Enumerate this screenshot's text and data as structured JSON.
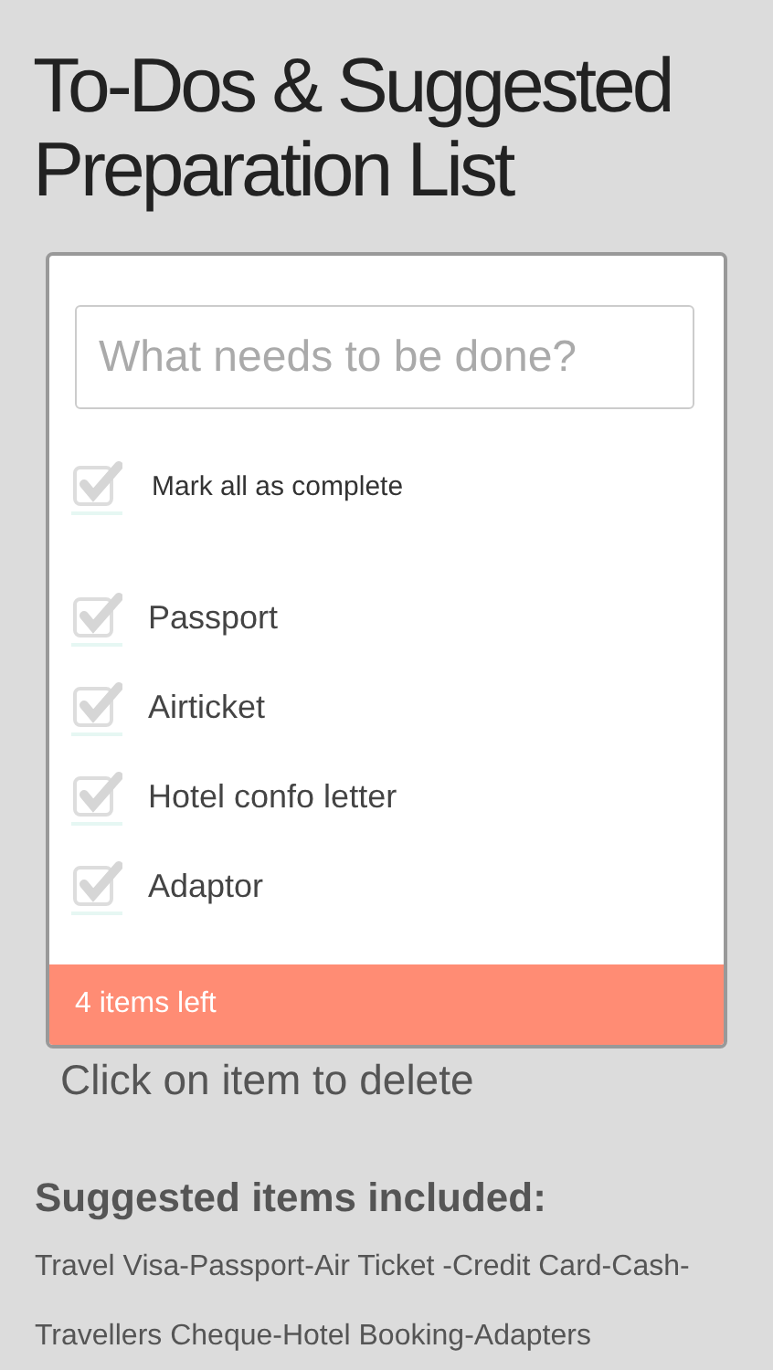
{
  "title": "To-Dos & Suggested Preparation List",
  "todo": {
    "placeholder": "What needs to be done?",
    "mark_all": {
      "label": "Mark all as complete",
      "checked": false
    },
    "items": [
      {
        "label": "Passport",
        "checked": false
      },
      {
        "label": "Airticket",
        "checked": false
      },
      {
        "label": "Hotel confo letter",
        "checked": false
      },
      {
        "label": "Adaptor",
        "checked": false
      }
    ],
    "footer": "4 items left"
  },
  "hint": "Click on item to delete",
  "suggested": {
    "heading": "Suggested items included:",
    "text": "Travel Visa-Passport-Air Ticket -Credit Card-Cash-Travellers Cheque-Hotel Booking-Adapters"
  }
}
